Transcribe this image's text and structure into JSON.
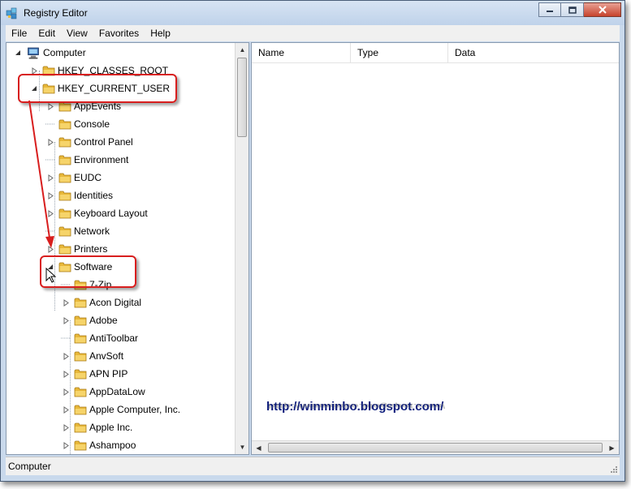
{
  "window": {
    "title": "Registry Editor",
    "buttons": [
      "minimize",
      "maximize",
      "close"
    ]
  },
  "menu": [
    "File",
    "Edit",
    "View",
    "Favorites",
    "Help"
  ],
  "tree": {
    "root": "Computer",
    "items": [
      {
        "label": "HKEY_CLASSES_ROOT",
        "level": 1,
        "expander": "collapsed",
        "highlighted": false
      },
      {
        "label": "HKEY_CURRENT_USER",
        "level": 1,
        "expander": "expanded",
        "highlighted": true
      },
      {
        "label": "AppEvents",
        "level": 2,
        "expander": "collapsed"
      },
      {
        "label": "Console",
        "level": 2,
        "expander": "none"
      },
      {
        "label": "Control Panel",
        "level": 2,
        "expander": "collapsed"
      },
      {
        "label": "Environment",
        "level": 2,
        "expander": "none"
      },
      {
        "label": "EUDC",
        "level": 2,
        "expander": "collapsed"
      },
      {
        "label": "Identities",
        "level": 2,
        "expander": "collapsed"
      },
      {
        "label": "Keyboard Layout",
        "level": 2,
        "expander": "collapsed"
      },
      {
        "label": "Network",
        "level": 2,
        "expander": "none"
      },
      {
        "label": "Printers",
        "level": 2,
        "expander": "collapsed"
      },
      {
        "label": "Software",
        "level": 2,
        "expander": "expanded",
        "highlighted": true
      },
      {
        "label": "7-Zip",
        "level": 3,
        "expander": "none"
      },
      {
        "label": "Acon Digital",
        "level": 3,
        "expander": "collapsed"
      },
      {
        "label": "Adobe",
        "level": 3,
        "expander": "collapsed"
      },
      {
        "label": "AntiToolbar",
        "level": 3,
        "expander": "none"
      },
      {
        "label": "AnvSoft",
        "level": 3,
        "expander": "collapsed"
      },
      {
        "label": "APN PIP",
        "level": 3,
        "expander": "collapsed"
      },
      {
        "label": "AppDataLow",
        "level": 3,
        "expander": "collapsed"
      },
      {
        "label": "Apple Computer, Inc.",
        "level": 3,
        "expander": "collapsed"
      },
      {
        "label": "Apple Inc.",
        "level": 3,
        "expander": "collapsed"
      },
      {
        "label": "Ashampoo",
        "level": 3,
        "expander": "collapsed"
      }
    ]
  },
  "list": {
    "columns": [
      "Name",
      "Type",
      "Data"
    ]
  },
  "watermark": "http://winminbo.blogspot.com/",
  "status": "Computer",
  "colors": {
    "annotation": "#d81e1e",
    "folder": "#e8b83a",
    "titlebar": "#c9d9ec",
    "watermark": "#0a1a7a"
  }
}
